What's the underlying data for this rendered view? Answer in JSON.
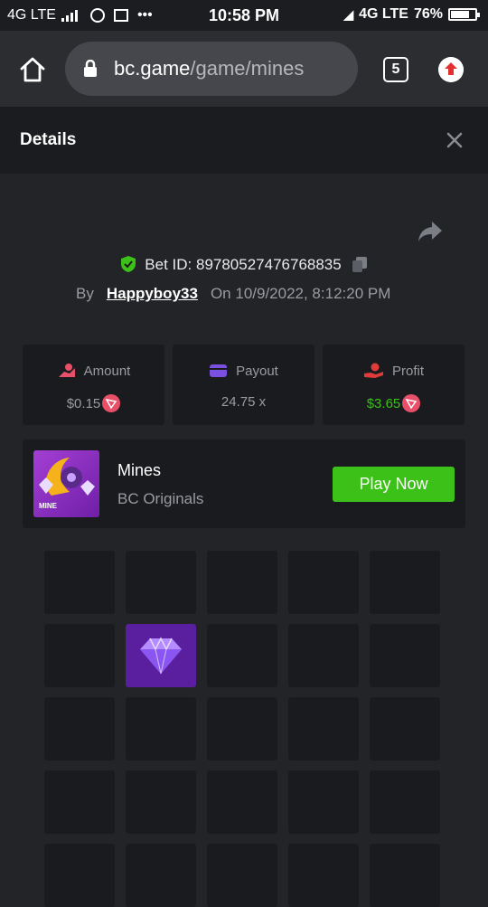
{
  "status_bar": {
    "network_left": "4G LTE",
    "time": "10:58 PM",
    "network_right": "4G LTE",
    "battery": "76%",
    "battery_level": 0.76
  },
  "browser": {
    "domain": "bc.game",
    "path": "/game/mines",
    "tab_count": "5"
  },
  "details": {
    "title": "Details",
    "bet_id_label": "Bet ID:",
    "bet_id": "89780527476768835",
    "by_label": "By",
    "username": "Happyboy33",
    "on_label": "On",
    "datetime": "10/9/2022, 8:12:20 PM"
  },
  "stats": {
    "amount_label": "Amount",
    "amount_value": "$0.15",
    "payout_label": "Payout",
    "payout_value": "24.75 x",
    "profit_label": "Profit",
    "profit_value": "$3.65"
  },
  "game": {
    "name": "Mines",
    "provider": "BC Originals",
    "thumb_text": "MINE",
    "play_label": "Play Now"
  },
  "colors": {
    "accent_green": "#3bc117",
    "gem_tile": "#5a1f9e",
    "token": "#e8506a"
  },
  "grid": {
    "columns": 5,
    "rows_visible": 5,
    "revealed_gem": {
      "row": 2,
      "col": 2
    }
  }
}
